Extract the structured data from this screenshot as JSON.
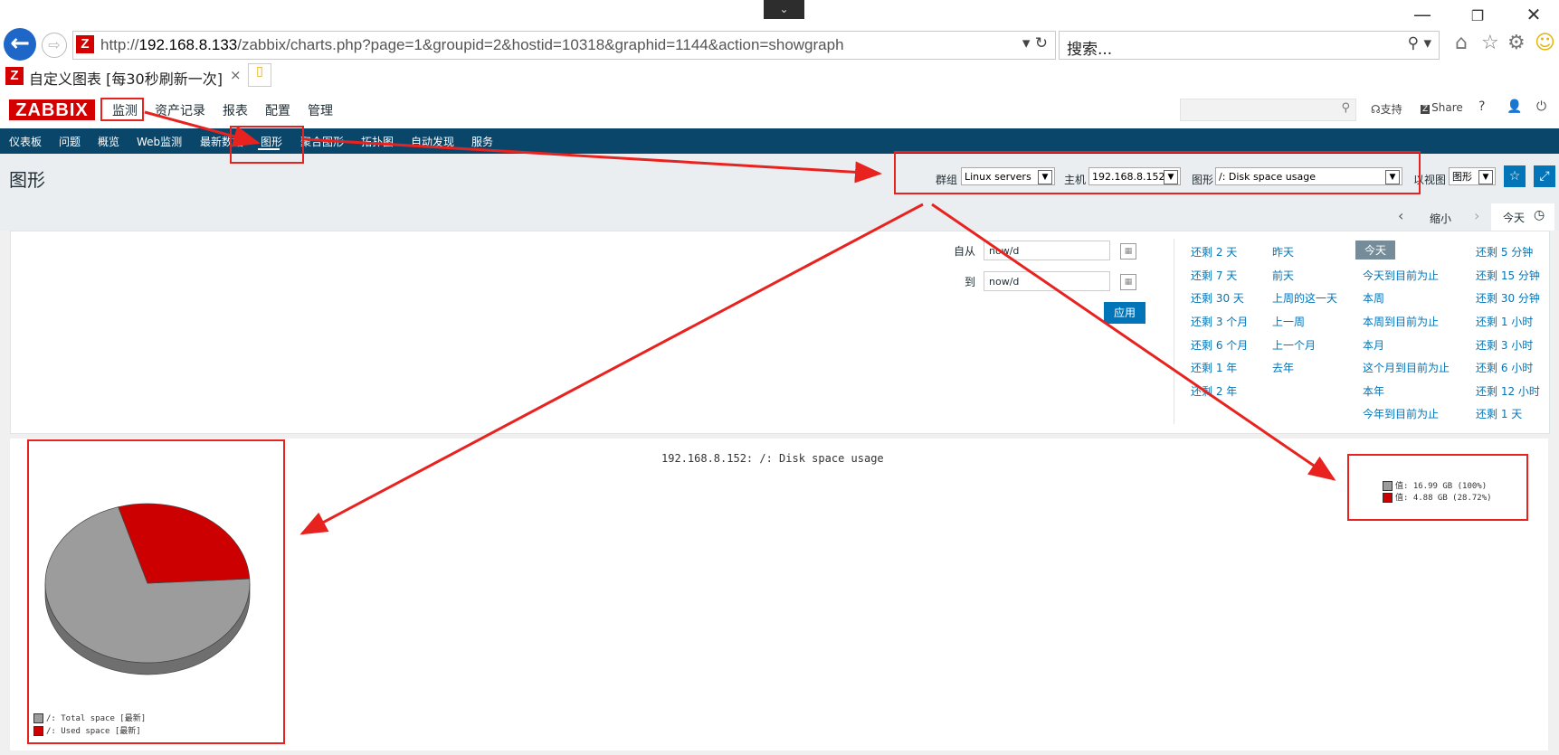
{
  "browser": {
    "url_prefix": "http://",
    "url_host": "192.168.8.133",
    "url_rest": "/zabbix/charts.php?page=1&groupid=2&hostid=10318&graphid=1144&action=showgraph",
    "search_placeholder": "搜索...",
    "tab_title": "自定义图表 [每30秒刷新一次]",
    "tab_close": "×"
  },
  "header": {
    "logo": "ZABBIX",
    "menu": [
      "监测",
      "资产记录",
      "报表",
      "配置",
      "管理"
    ],
    "support": "支持",
    "share": "Share",
    "help": "?"
  },
  "subnav": [
    "仪表板",
    "问题",
    "概览",
    "Web监测",
    "最新数据",
    "图形",
    "聚合图形",
    "拓扑图",
    "自动发现",
    "服务"
  ],
  "page": {
    "title": "图形",
    "filters": {
      "group_label": "群组",
      "group_value": "Linux servers",
      "host_label": "主机",
      "host_value": "192.168.8.152",
      "graph_label": "图形",
      "graph_value": "/: Disk space usage",
      "view_label": "以视图",
      "view_value": "图形"
    }
  },
  "timenav": {
    "zoom_out": "缩小",
    "current": "今天"
  },
  "time_filter": {
    "from_label": "自从",
    "from_value": "now/d",
    "to_label": "到",
    "to_value": "now/d",
    "apply": "应用",
    "col1": [
      "还剩 2 天",
      "还剩 7 天",
      "还剩 30 天",
      "还剩 3 个月",
      "还剩 6 个月",
      "还剩 1 年",
      "还剩 2 年"
    ],
    "col2": [
      "昨天",
      "前天",
      "上周的这一天",
      "上一周",
      "上一个月",
      "去年"
    ],
    "col3": [
      "今天",
      "今天到目前为止",
      "本周",
      "本周到目前为止",
      "本月",
      "这个月到目前为止",
      "本年",
      "今年到目前为止"
    ],
    "col4": [
      "还剩 5 分钟",
      "还剩 15 分钟",
      "还剩 30 分钟",
      "还剩 1 小时",
      "还剩 3 小时",
      "还剩 6 小时",
      "还剩 12 小时",
      "还剩 1 天"
    ]
  },
  "graph": {
    "title": "192.168.8.152: /: Disk space usage",
    "legend_right": [
      "值: 16.99 GB (100%)",
      "值: 4.88 GB (28.72%)"
    ],
    "legend_bottom": [
      "/: Total space  [最新]",
      "/: Used space   [最新]"
    ]
  },
  "chart_data": {
    "type": "pie",
    "title": "192.168.8.152: /: Disk space usage",
    "series": [
      {
        "name": "/: Total space",
        "value": 16.99,
        "unit": "GB",
        "color": "#9c9c9c"
      },
      {
        "name": "/: Used space",
        "value": 4.88,
        "unit": "GB",
        "percent": 28.72,
        "color": "#cc0000"
      }
    ]
  }
}
